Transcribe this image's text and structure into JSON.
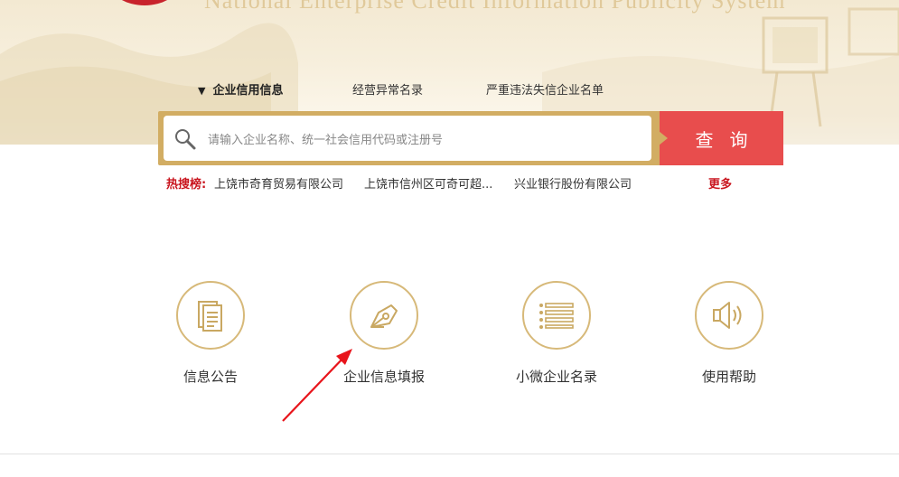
{
  "header": {
    "site_title": "National Enterprise Credit Information Publicity System"
  },
  "tabs": [
    {
      "label": "企业信用信息",
      "active": true
    },
    {
      "label": "经营异常名录",
      "active": false
    },
    {
      "label": "严重违法失信企业名单",
      "active": false
    }
  ],
  "search": {
    "placeholder": "请输入企业名称、统一社会信用代码或注册号",
    "button_label": "查询"
  },
  "hot_search": {
    "label": "热搜榜:",
    "items": [
      "上饶市奇育贸易有限公司",
      "上饶市信州区可奇可超...",
      "兴业银行股份有限公司"
    ],
    "more_label": "更多"
  },
  "services": [
    {
      "label": "信息公告",
      "icon": "document-icon"
    },
    {
      "label": "企业信息填报",
      "icon": "pen-nib-icon"
    },
    {
      "label": "小微企业名录",
      "icon": "list-icon"
    },
    {
      "label": "使用帮助",
      "icon": "speaker-icon"
    }
  ],
  "colors": {
    "accent_gold": "#d2ad63",
    "search_red": "#e84d4d",
    "hot_red": "#c9151e",
    "annotation_arrow": "#e8141b"
  }
}
